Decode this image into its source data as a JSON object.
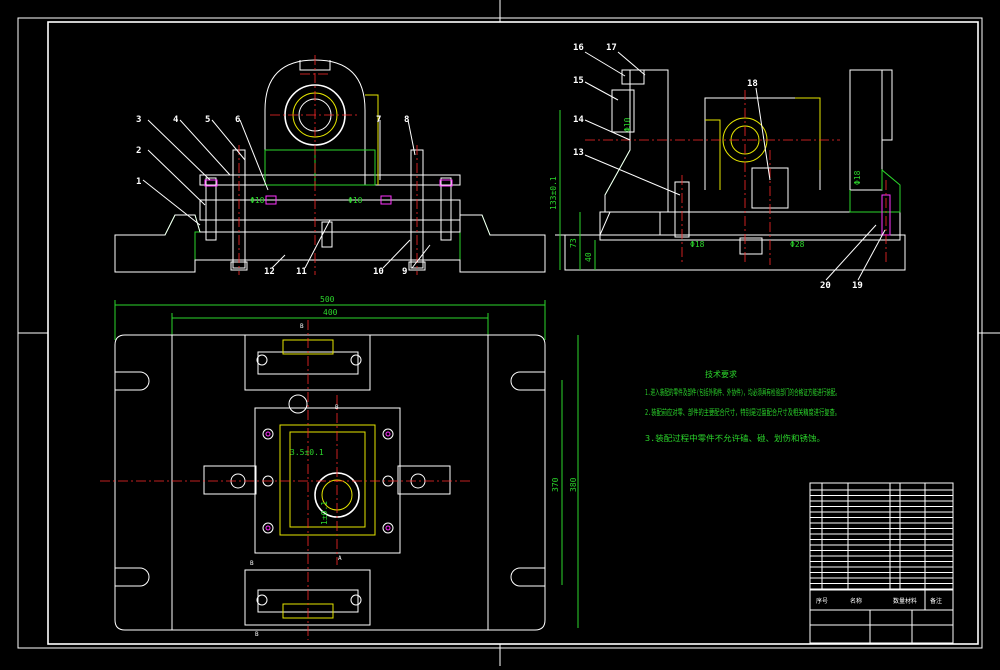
{
  "drawing": {
    "front_view_labels": [
      "1",
      "2",
      "3",
      "4",
      "5",
      "6",
      "7",
      "8",
      "9",
      "10",
      "11",
      "12"
    ],
    "side_view_labels": [
      "13",
      "14",
      "15",
      "16",
      "17",
      "18",
      "19",
      "20"
    ],
    "section_marks": {
      "a1": "B",
      "a2": "B",
      "b1": "B",
      "b2": "B",
      "cut": "A"
    }
  },
  "dimensions": {
    "overall_width": "500",
    "inner_width": "400",
    "overall_height": "380",
    "inner_height": "370",
    "side_height_total": "133±0.1",
    "side_h1": "73",
    "side_h2": "40",
    "phi_front_a": "Φ10",
    "phi_front_b": "Φ10",
    "phi_side_a": "Φ10",
    "phi_side_b": "Φ18",
    "phi_side_c": "Φ28",
    "phi_side_d": "Φ18",
    "plan_dim_a": "3.5±0.1",
    "plan_dim_b": "1±0.1"
  },
  "technical_requirements": {
    "title": "技术要求",
    "lines": [
      "1.进入装配的零件及部件(包括外购件、外协件)，均必须具有检验部门的合格证方能进行装配。",
      "2.装配前应对零、部件的主要配合尺寸，特别是过盈配合尺寸及相关精度进行复查。",
      "3.装配过程中零件不允许磕、碰、划伤和锈蚀。"
    ]
  },
  "title_block": {
    "headers": [
      "序号",
      "名称",
      "数量",
      "材料",
      "备注"
    ]
  },
  "colors": {
    "background": "#000000",
    "outline": "#ffffff",
    "hatch": "#2bd62b",
    "centerline": "#ff2a2a",
    "highlight": "#e6e600",
    "bolt": "#ff33ff"
  }
}
